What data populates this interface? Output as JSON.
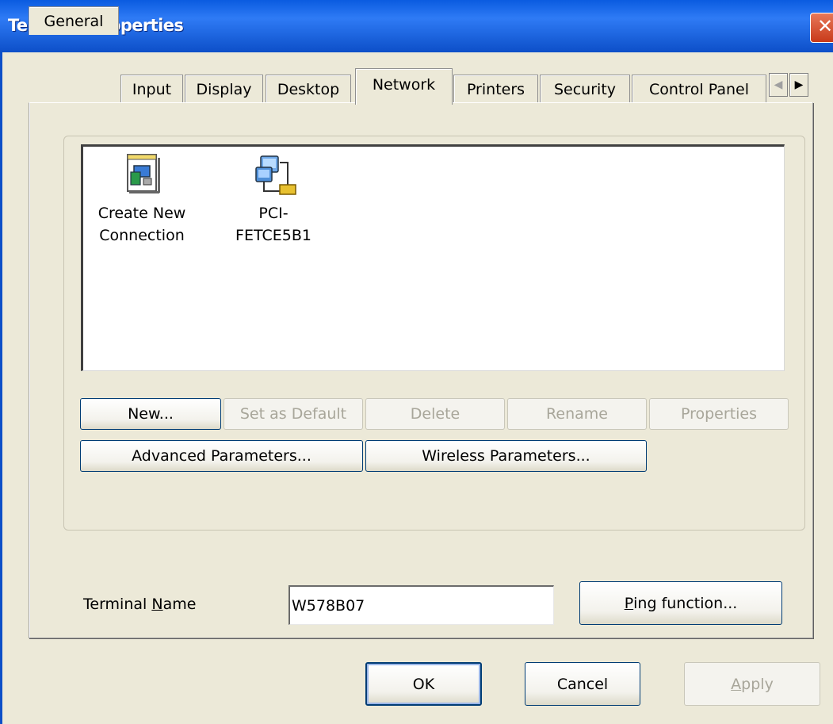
{
  "window": {
    "title": "Terminal Properties",
    "close_glyph": "✕"
  },
  "tabs": [
    {
      "label": "General"
    },
    {
      "label": "Input"
    },
    {
      "label": "Display"
    },
    {
      "label": "Desktop"
    },
    {
      "label": "Network",
      "active": true
    },
    {
      "label": "Printers"
    },
    {
      "label": "Security"
    },
    {
      "label": "Control Panel"
    }
  ],
  "tab_scroll": {
    "left": "◀",
    "right": "▶"
  },
  "connections": [
    {
      "label": "Create New\nConnection",
      "icon": "new-connection-icon"
    },
    {
      "label": "PCI-\nFETCE5B1",
      "icon": "network-adapter-icon"
    }
  ],
  "connection_buttons": {
    "new": "New...",
    "set_default": "Set as Default",
    "delete": "Delete",
    "rename": "Rename",
    "properties": "Properties",
    "advanced": "Advanced Parameters...",
    "wireless": "Wireless Parameters..."
  },
  "terminal_name": {
    "label_prefix": "Terminal ",
    "label_accel": "N",
    "label_suffix": "ame",
    "value": "W578B07"
  },
  "ping": {
    "accel": "P",
    "rest": "ing function..."
  },
  "dialog_buttons": {
    "ok": "OK",
    "cancel": "Cancel",
    "apply_accel": "A",
    "apply_rest": "pply"
  }
}
